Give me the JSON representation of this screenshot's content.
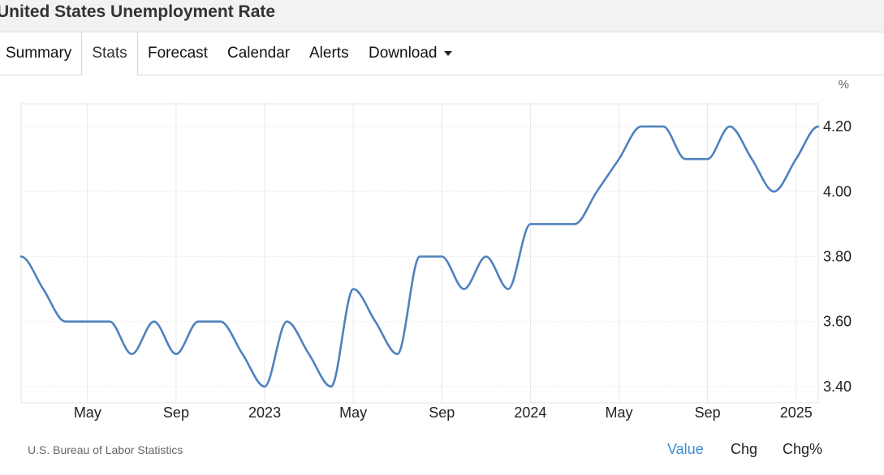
{
  "page_title": "United States Unemployment Rate",
  "tabs": [
    {
      "label": "Summary"
    },
    {
      "label": "Stats",
      "active": true
    },
    {
      "label": "Forecast"
    },
    {
      "label": "Calendar"
    },
    {
      "label": "Alerts"
    },
    {
      "label": "Download",
      "icon": "caret-down-icon"
    }
  ],
  "source": "U.S. Bureau of Labor Statistics",
  "modes": [
    {
      "label": "Value",
      "active": true
    },
    {
      "label": "Chg"
    },
    {
      "label": "Chg%"
    }
  ],
  "colors": {
    "line": "#4f81bd",
    "active_mode": "#3a8fd6"
  },
  "chart_data": {
    "type": "line",
    "title": "United States Unemployment Rate",
    "y_unit": "%",
    "ylim": [
      3.35,
      4.27
    ],
    "y_ticks": [
      3.4,
      3.6,
      3.8,
      4.0,
      4.2
    ],
    "y_tick_labels": [
      "3.40",
      "3.60",
      "3.80",
      "4.00",
      "4.20"
    ],
    "x_tick_labels": [
      "May",
      "Sep",
      "2023",
      "May",
      "Sep",
      "2024",
      "May",
      "Sep",
      "2025"
    ],
    "grid": true,
    "y_axis_position": "right",
    "series": [
      {
        "color": "#4f81bd",
        "points": [
          {
            "x": "2022-02",
            "y": 3.8
          },
          {
            "x": "2022-03",
            "y": 3.7
          },
          {
            "x": "2022-04",
            "y": 3.6
          },
          {
            "x": "2022-05",
            "y": 3.6
          },
          {
            "x": "2022-06",
            "y": 3.6
          },
          {
            "x": "2022-07",
            "y": 3.5
          },
          {
            "x": "2022-08",
            "y": 3.6
          },
          {
            "x": "2022-09",
            "y": 3.5
          },
          {
            "x": "2022-10",
            "y": 3.6
          },
          {
            "x": "2022-11",
            "y": 3.6
          },
          {
            "x": "2022-12",
            "y": 3.5
          },
          {
            "x": "2023-01",
            "y": 3.4
          },
          {
            "x": "2023-02",
            "y": 3.6
          },
          {
            "x": "2023-03",
            "y": 3.5
          },
          {
            "x": "2023-04",
            "y": 3.4
          },
          {
            "x": "2023-05",
            "y": 3.7
          },
          {
            "x": "2023-06",
            "y": 3.6
          },
          {
            "x": "2023-07",
            "y": 3.5
          },
          {
            "x": "2023-08",
            "y": 3.8
          },
          {
            "x": "2023-09",
            "y": 3.8
          },
          {
            "x": "2023-10",
            "y": 3.7
          },
          {
            "x": "2023-11",
            "y": 3.8
          },
          {
            "x": "2023-12",
            "y": 3.7
          },
          {
            "x": "2024-01",
            "y": 3.9
          },
          {
            "x": "2024-02",
            "y": 3.9
          },
          {
            "x": "2024-03",
            "y": 3.9
          },
          {
            "x": "2024-04",
            "y": 4.0
          },
          {
            "x": "2024-05",
            "y": 4.1
          },
          {
            "x": "2024-06",
            "y": 4.2
          },
          {
            "x": "2024-07",
            "y": 4.2
          },
          {
            "x": "2024-08",
            "y": 4.1
          },
          {
            "x": "2024-09",
            "y": 4.1
          },
          {
            "x": "2024-10",
            "y": 4.2
          },
          {
            "x": "2024-11",
            "y": 4.1
          },
          {
            "x": "2024-12",
            "y": 4.0
          },
          {
            "x": "2025-01",
            "y": 4.1
          },
          {
            "x": "2025-02",
            "y": 4.2
          }
        ]
      }
    ]
  }
}
